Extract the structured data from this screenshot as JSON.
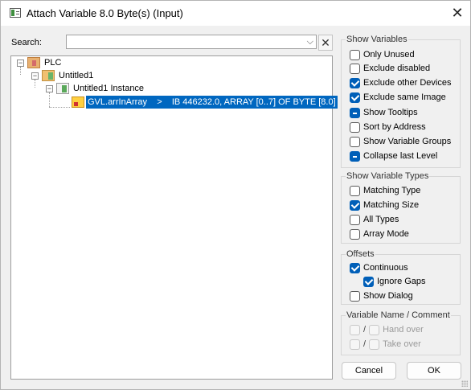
{
  "window": {
    "title": "Attach Variable 8.0 Byte(s) (Input)",
    "close_glyph": "✕"
  },
  "search": {
    "label": "Search:",
    "value": "",
    "placeholder": "",
    "dropdown_glyph": "⌵",
    "clear_glyph": "✕"
  },
  "tree": {
    "nodes": [
      {
        "label": "PLC",
        "icon": "plc-icon",
        "expander": "−"
      },
      {
        "label": "Untitled1",
        "icon": "project-icon",
        "expander": "−"
      },
      {
        "label": "Untitled1 Instance",
        "icon": "instance-icon",
        "expander": "−"
      },
      {
        "label": "GVL.arrInArray    >    IB 446232.0, ARRAY [0..7] OF BYTE [8.0]",
        "icon": "variable-icon",
        "selected": true
      }
    ]
  },
  "show_variables": {
    "title": "Show Variables",
    "items": [
      {
        "label": "Only Unused",
        "state": "unchecked"
      },
      {
        "label": "Exclude disabled",
        "state": "unchecked"
      },
      {
        "label": "Exclude other Devices",
        "state": "checked"
      },
      {
        "label": "Exclude same Image",
        "state": "checked"
      },
      {
        "label": "Show Tooltips",
        "state": "indeterminate"
      },
      {
        "label": "Sort by Address",
        "state": "unchecked"
      },
      {
        "label": "Show Variable Groups",
        "state": "unchecked"
      },
      {
        "label": "Collapse last Level",
        "state": "indeterminate"
      }
    ]
  },
  "show_variable_types": {
    "title": "Show Variable Types",
    "items": [
      {
        "label": "Matching Type",
        "state": "unchecked"
      },
      {
        "label": "Matching Size",
        "state": "checked"
      },
      {
        "label": "All Types",
        "state": "unchecked"
      },
      {
        "label": "Array Mode",
        "state": "unchecked"
      }
    ]
  },
  "offsets": {
    "title": "Offsets",
    "items": [
      {
        "label": "Continuous",
        "state": "checked"
      },
      {
        "label": "Ignore Gaps",
        "state": "checked"
      },
      {
        "label": "Show Dialog",
        "state": "unchecked"
      }
    ]
  },
  "variable_name_comment": {
    "title": "Variable Name / Comment",
    "separator": "/",
    "hand_over": "Hand over",
    "take_over": "Take over"
  },
  "buttons": {
    "cancel": "Cancel",
    "ok": "OK"
  },
  "colors": {
    "selection": "#0067c0",
    "checkbox_checked": "#005fb8"
  }
}
